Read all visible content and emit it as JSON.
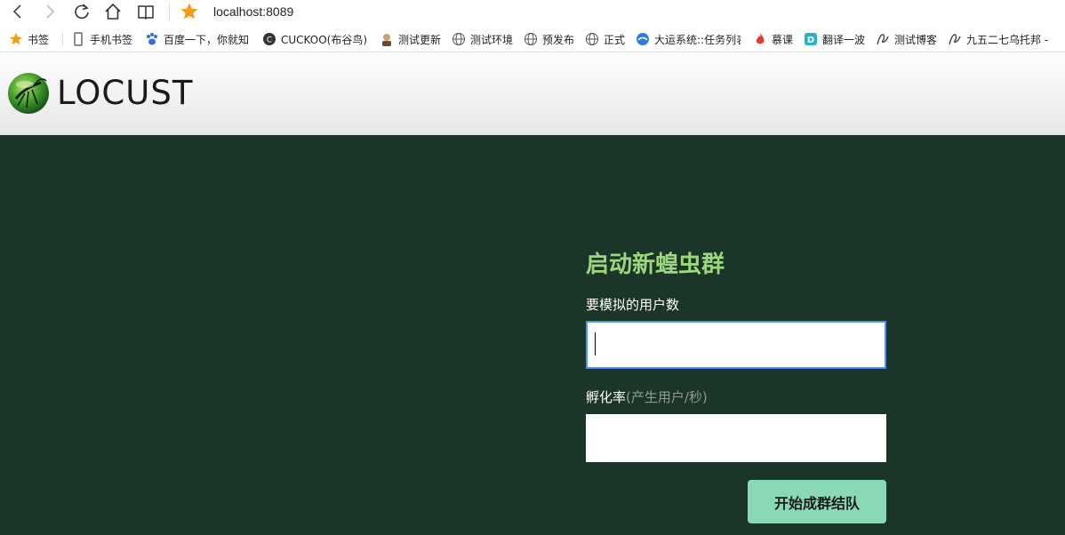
{
  "browser": {
    "url": "localhost:8089",
    "bookmarks": [
      {
        "label": "书签",
        "icon": "star-icon"
      },
      {
        "label": "手机书签",
        "icon": "phone-icon"
      },
      {
        "label": "百度一下，你就知",
        "icon": "baidu-paw-icon"
      },
      {
        "label": "CUCKOO(布谷鸟)",
        "icon": "cuckoo-icon"
      },
      {
        "label": "测试更新",
        "icon": "avatar-icon"
      },
      {
        "label": "测试环境",
        "icon": "globe-icon"
      },
      {
        "label": "预发布",
        "icon": "globe-icon"
      },
      {
        "label": "正式",
        "icon": "globe-icon"
      },
      {
        "label": "大运系统::任务列表",
        "icon": "system-globe-icon"
      },
      {
        "label": "慕课",
        "icon": "flame-icon"
      },
      {
        "label": "翻译一波",
        "icon": "translate-icon"
      },
      {
        "label": "测试博客",
        "icon": "blog-icon"
      },
      {
        "label": "九五二七乌托邦 -",
        "icon": "blog-icon"
      }
    ]
  },
  "header": {
    "logo_text": "LOCUST"
  },
  "form": {
    "title": "启动新蝗虫群",
    "users_label": "要模拟的用户数",
    "users_value": "",
    "rate_label": "孵化率",
    "rate_hint": "(产生用户/秒)",
    "rate_value": "",
    "start_button": "开始成群结队"
  },
  "colors": {
    "background": "#1b3529",
    "title": "#9cd77e",
    "button": "#8ad9b6",
    "bookmark_star": "#f39c12"
  }
}
